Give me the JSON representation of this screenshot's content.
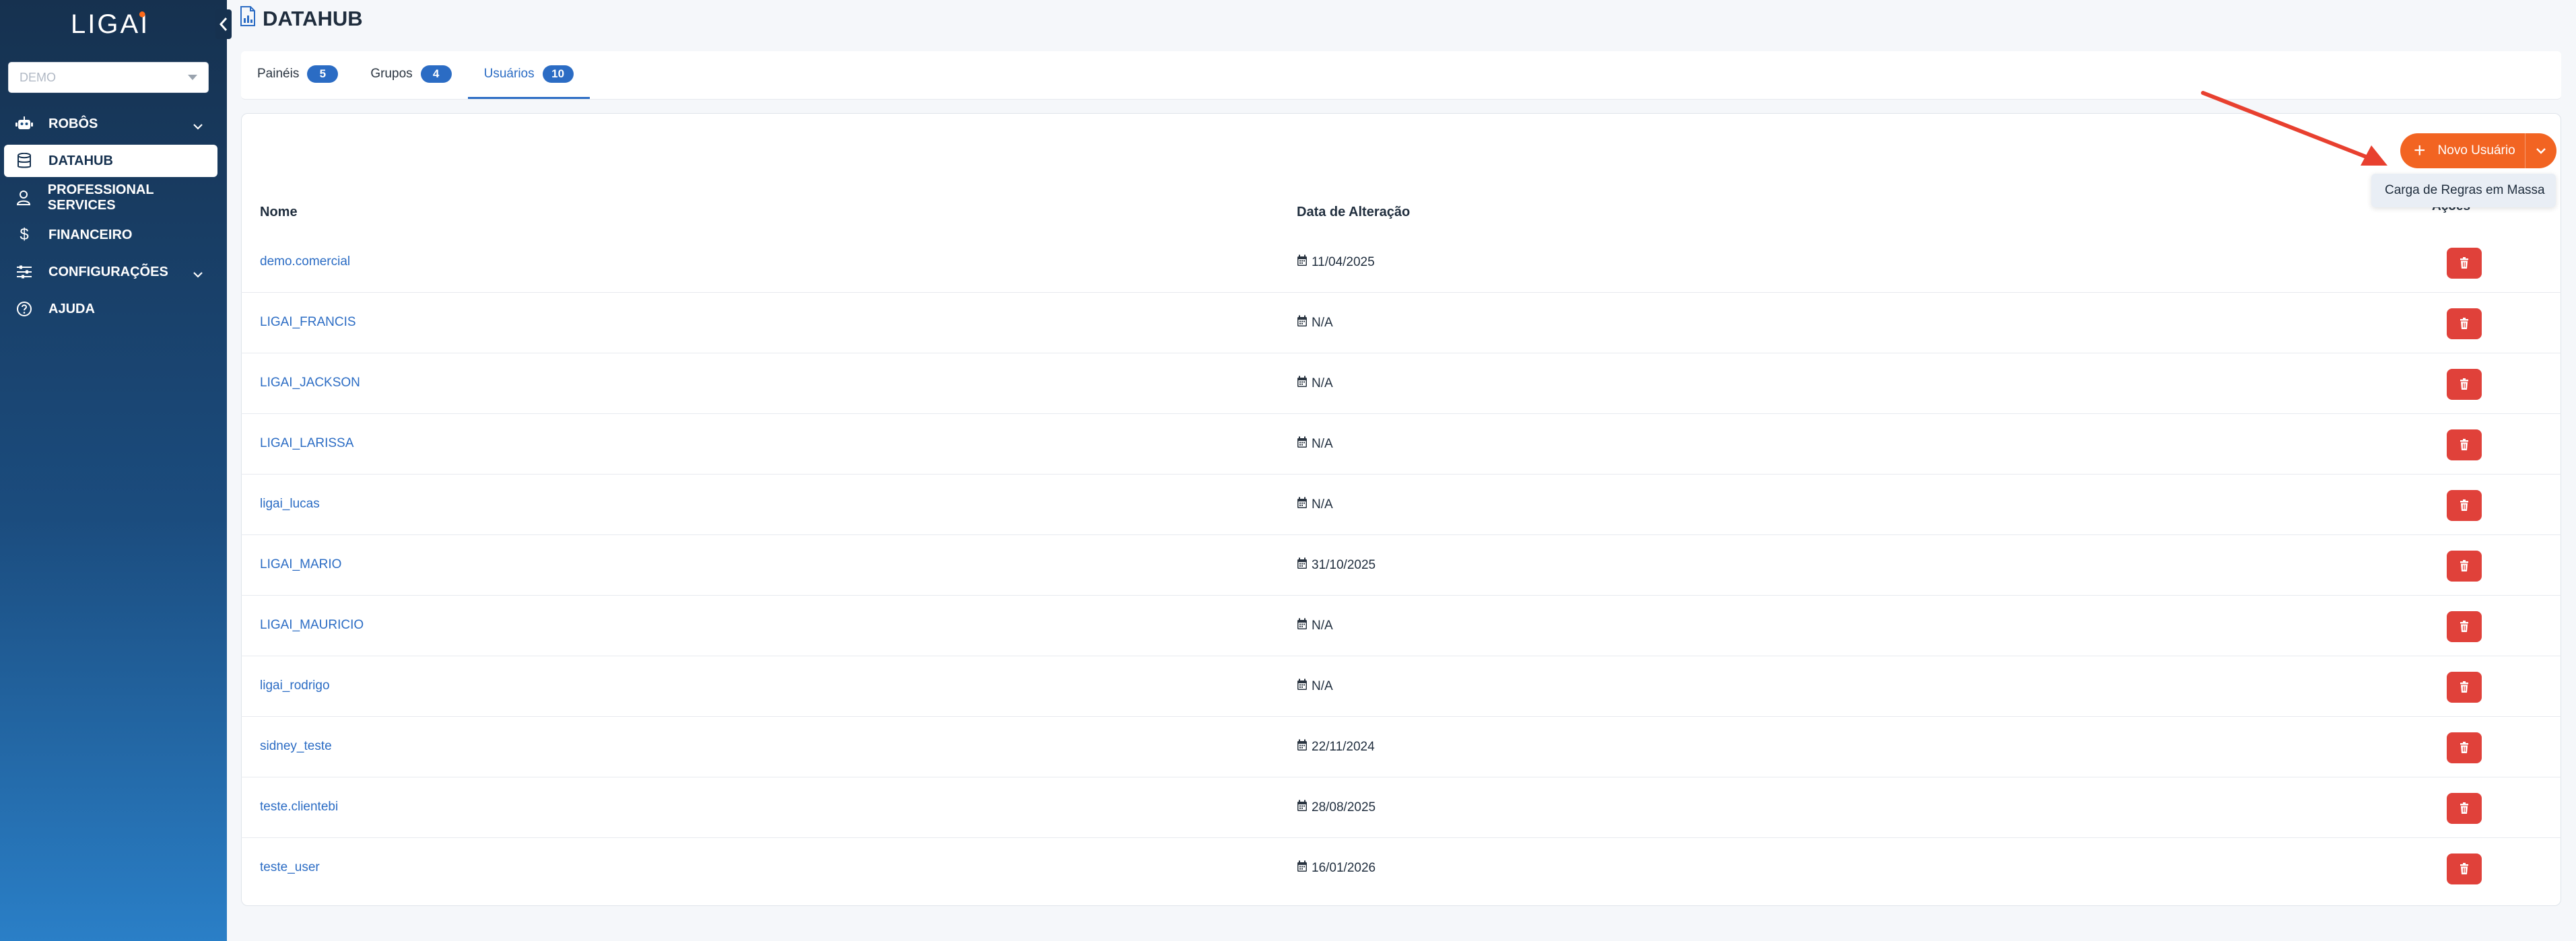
{
  "sidebar": {
    "logo_text": "LIGAI",
    "org_select": {
      "value": "DEMO"
    },
    "items": [
      {
        "label": "ROBÔS",
        "icon": "robot-icon",
        "has_chevron": true,
        "active": false
      },
      {
        "label": "DATAHUB",
        "icon": "database-icon",
        "has_chevron": false,
        "active": true
      },
      {
        "label": "PROFESSIONAL SERVICES",
        "icon": "user-icon",
        "has_chevron": false,
        "active": false
      },
      {
        "label": "FINANCEIRO",
        "icon": "dollar-icon",
        "has_chevron": false,
        "active": false
      },
      {
        "label": "CONFIGURAÇÕES",
        "icon": "sliders-icon",
        "has_chevron": true,
        "active": false
      },
      {
        "label": "AJUDA",
        "icon": "help-icon",
        "has_chevron": false,
        "active": false
      }
    ]
  },
  "header": {
    "title": "DATAHUB"
  },
  "tabs": [
    {
      "label": "Painéis",
      "count": "5",
      "active": false
    },
    {
      "label": "Grupos",
      "count": "4",
      "active": false
    },
    {
      "label": "Usuários",
      "count": "10",
      "active": true
    }
  ],
  "toolbar": {
    "new_user_label": "Novo Usuário",
    "dropdown_item": "Carga de Regras em Massa"
  },
  "table": {
    "columns": {
      "name": "Nome",
      "date": "Data de Alteração",
      "actions": "Ações"
    },
    "rows": [
      {
        "name": "demo.comercial",
        "date": "11/04/2025"
      },
      {
        "name": "LIGAI_FRANCIS",
        "date": "N/A"
      },
      {
        "name": "LIGAI_JACKSON",
        "date": "N/A"
      },
      {
        "name": "LIGAI_LARISSA",
        "date": "N/A"
      },
      {
        "name": "ligai_lucas",
        "date": "N/A"
      },
      {
        "name": "LIGAI_MARIO",
        "date": "31/10/2025"
      },
      {
        "name": "LIGAI_MAURICIO",
        "date": "N/A"
      },
      {
        "name": "ligai_rodrigo",
        "date": "N/A"
      },
      {
        "name": "sidney_teste",
        "date": "22/11/2024"
      },
      {
        "name": "teste.clientebi",
        "date": "28/08/2025"
      },
      {
        "name": "teste_user",
        "date": "16/01/2026"
      }
    ]
  },
  "colors": {
    "accent": "#2b6cc4",
    "primary_button": "#f26422",
    "delete_button": "#e0413a",
    "sidebar_dark": "#16314f",
    "annotation_arrow": "#e8402f"
  }
}
